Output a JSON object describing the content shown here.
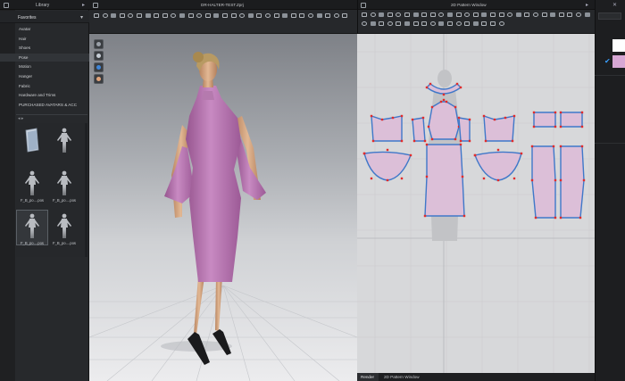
{
  "library": {
    "title": "Library",
    "favorites_label": "Favorites",
    "items": [
      {
        "label": "Avatar"
      },
      {
        "label": "Hair"
      },
      {
        "label": "Shoes"
      },
      {
        "label": "Pose",
        "selected": true
      },
      {
        "label": "Motion"
      },
      {
        "label": "Hanger"
      },
      {
        "label": "Fabric"
      },
      {
        "label": "Hardware and Trims"
      },
      {
        "label": "PURCHASED AVATARS & ACC"
      }
    ],
    "thumbnails": [
      {
        "caption": "",
        "icon": "folder-icon"
      },
      {
        "caption": "",
        "icon": "avatar-pose-icon"
      },
      {
        "caption": "F_B_po....pos",
        "icon": "avatar-pose-icon"
      },
      {
        "caption": "F_B_po....pos",
        "icon": "avatar-pose-icon"
      },
      {
        "caption": "F_B_po....pos",
        "icon": "avatar-pose-icon",
        "selected": true
      },
      {
        "caption": "F_B_po....pos",
        "icon": "avatar-pose-icon"
      }
    ]
  },
  "viewport3d": {
    "title": "DR-HALTER-TEST.Zprj",
    "side_tools": [
      "display-avatar-icon",
      "display-garment-icon",
      "display-render-icon",
      "display-skin-icon"
    ]
  },
  "pattern2d": {
    "title": "2D Pattern Window"
  },
  "tabs": [
    {
      "label": "Render",
      "active": false
    },
    {
      "label": "2D Pattern Window",
      "active": true
    }
  ],
  "colors": {
    "garment": "#b476b0",
    "pattern_fill": "#dcbfd8",
    "pattern_outline": "#3f78c9",
    "point": "#e22b2b",
    "swatch_white": "#ffffff",
    "swatch_pink": "#d7a7d4",
    "check": "#3aa0ff"
  }
}
